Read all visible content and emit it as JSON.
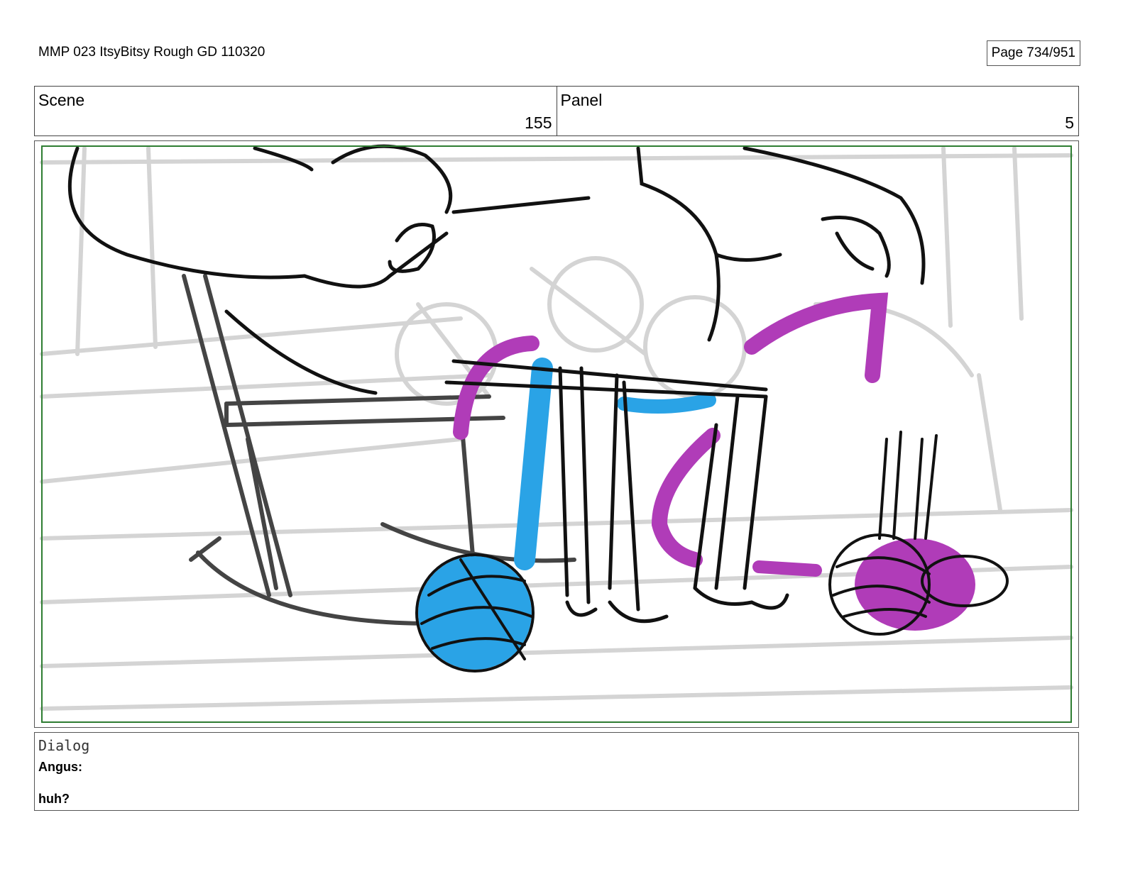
{
  "header": {
    "doc_title": "MMP 023 ItsyBitsy Rough GD 110320",
    "page": "Page 734/951"
  },
  "info": {
    "scene_label": "Scene",
    "scene_value": "155",
    "panel_label": "Panel",
    "panel_value": "5"
  },
  "colors": {
    "frame_border": "#2e7d32",
    "yarn_blue": "#2aa3e6",
    "yarn_magenta": "#b03cb8",
    "ink": "#111111",
    "background_sketch": "#d6d6d6"
  },
  "dialog": {
    "label": "Dialog",
    "speaker": "Angus:",
    "line": "huh?"
  }
}
